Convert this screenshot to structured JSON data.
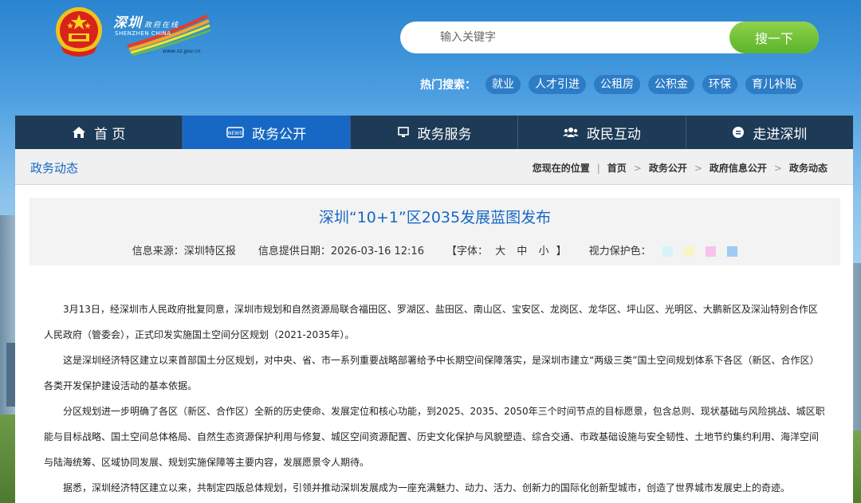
{
  "header": {
    "logo": {
      "cn": "深圳",
      "cn_small": "政府在线",
      "en": "SHENZHEN CHINA",
      "url": "www.sz.gov.cn"
    },
    "search": {
      "placeholder": "输入关键字",
      "button": "搜一下"
    },
    "hot": {
      "label": "热门搜索：",
      "tags": [
        "就业",
        "人才引进",
        "公租房",
        "公积金",
        "环保",
        "育儿补贴"
      ]
    }
  },
  "nav": {
    "items": [
      {
        "label": "首 页",
        "icon": "home-icon"
      },
      {
        "label": "政务公开",
        "icon": "news-icon"
      },
      {
        "label": "政务服务",
        "icon": "monitor-icon"
      },
      {
        "label": "政民互动",
        "icon": "people-icon"
      },
      {
        "label": "走进深圳",
        "icon": "info-icon"
      }
    ],
    "active_index": 1
  },
  "breadcrumb": {
    "section": "政务动态",
    "prefix": "您现在的位置",
    "items": [
      "首页",
      "政务公开",
      "政府信息公开",
      "政务动态"
    ]
  },
  "article": {
    "title": "深圳“10+1”区2035发展蓝图发布",
    "source": "信息来源：深圳特区报",
    "date": "信息提供日期：2026-03-16 12:16",
    "font_label_open": "【字体：",
    "font_sizes": [
      "大",
      "中",
      "小"
    ],
    "font_label_close": "】",
    "eye_label": "视力保护色：",
    "eye_colors": [
      "#d6f3fb",
      "#f7f5c3",
      "#f6c3ef",
      "#9fcaf3"
    ],
    "paragraphs": [
      "3月13日，经深圳市人民政府批复同意，深圳市规划和自然资源局联合福田区、罗湖区、盐田区、南山区、宝安区、龙岗区、龙华区、坪山区、光明区、大鹏新区及深汕特别合作区人民政府（管委会），正式印发实施国土空间分区规划（2021-2035年）。",
      "这是深圳经济特区建立以来首部国土分区规划，对中央、省、市一系列重要战略部署给予中长期空间保障落实，是深圳市建立“两级三类”国土空间规划体系下各区（新区、合作区）各类开发保护建设活动的基本依据。",
      "分区规划进一步明确了各区（新区、合作区）全新的历史使命、发展定位和核心功能，到2025、2035、2050年三个时间节点的目标愿景，包含总则、现状基础与风险挑战、城区职能与目标战略、国土空间总体格局、自然生态资源保护利用与修复、城区空间资源配置、历史文化保护与风貌塑造、综合交通、市政基础设施与安全韧性、土地节约集约利用、海洋空间与陆海统筹、区域协同发展、规划实施保障等主要内容，发展愿景令人期待。",
      "据悉，深圳经济特区建立以来，共制定四版总体规划，引领并推动深圳发展成为一座充满魅力、动力、活力、创新力的国际化创新型城市，创造了世界城市发展史上的奇迹。"
    ]
  }
}
